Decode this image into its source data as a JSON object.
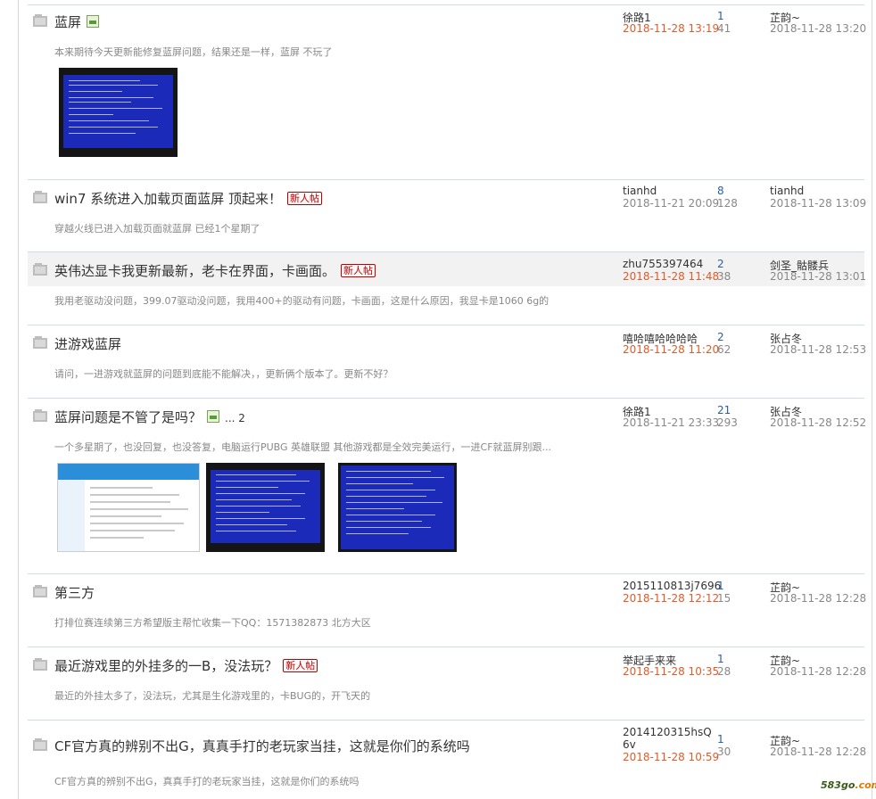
{
  "threads": [
    {
      "title": "蓝屏",
      "has_image_icon": true,
      "is_new": false,
      "desc": "本来期待今天更新能修复蓝屏问题，结果还是一样，蓝屏 不玩了",
      "author": "徐路1",
      "author_date": "2018-11-28 13:19",
      "replies": "1",
      "views": "41",
      "last_poster": "芷韵~",
      "last_date": "2018-11-28 13:20"
    },
    {
      "title": "win7 系统进入加载页面蓝屏 顶起来！",
      "is_new": true,
      "desc": "穿越火线已进入加载页面就蓝屏 已经1个星期了",
      "author": "tianhd",
      "author_date": "2018-11-21 20:09",
      "replies": "8",
      "views": "128",
      "last_poster": "tianhd",
      "last_date": "2018-11-28 13:09"
    },
    {
      "title": "英伟达显卡我更新最新，老卡在界面，卡画面。",
      "is_new": true,
      "desc": "我用老驱动没问题，399.07驱动没问题，我用400+的驱动有问题，卡画面，这是什么原因，我显卡是1060 6g的",
      "author": "zhu755397464",
      "author_date": "2018-11-28 11:48",
      "replies": "2",
      "views": "38",
      "last_poster": "剑圣_骷髅兵",
      "last_date": "2018-11-28 13:01"
    },
    {
      "title": "进游戏蓝屏",
      "desc": "请问，一进游戏就蓝屏的问题到底能不能解决，，更新俩个版本了。更新不好？",
      "author": "嘻哈嘻哈哈哈哈",
      "author_date": "2018-11-28 11:20",
      "replies": "2",
      "views": "62",
      "last_poster": "张占冬",
      "last_date": "2018-11-28 12:53"
    },
    {
      "title": "蓝屏问题是不管了是吗？",
      "has_image_icon": true,
      "pages": "... 2",
      "desc": "一个多星期了，也没回复，也没答复，电脑运行PUBG 英雄联盟 其他游戏都是全效完美运行，一进CF就蓝屏别跟...",
      "author": "徐路1",
      "author_date": "2018-11-21 23:33",
      "replies": "21",
      "views": "293",
      "last_poster": "张占冬",
      "last_date": "2018-11-28 12:52"
    },
    {
      "title": "第三方",
      "desc": "打排位赛连续第三方希望版主帮忙收集一下QQ：1571382873 北方大区",
      "author": "2015110813j7696",
      "author_date": "2018-11-28 12:12",
      "replies": "1",
      "views": "15",
      "last_poster": "芷韵~",
      "last_date": "2018-11-28 12:28"
    },
    {
      "title": "最近游戏里的外挂多的一B，没法玩？",
      "is_new": true,
      "desc": "最近的外挂太多了，没法玩，尤其是生化游戏里的，卡BUG的，开飞天的",
      "author": "举起手来来",
      "author_date": "2018-11-28 10:35",
      "replies": "1",
      "views": "28",
      "last_poster": "芷韵~",
      "last_date": "2018-11-28 12:28"
    },
    {
      "title": "CF官方真的辨别不出G，真真手打的老玩家当挂，这就是你们的系统吗",
      "desc": "CF官方真的辨别不出G，真真手打的老玩家当挂，这就是你们的系统吗",
      "author": "2014120315hsQ6v",
      "author_date": "2018-11-28 10:59",
      "replies": "1",
      "views": "30",
      "last_poster": "芷韵~",
      "last_date": "2018-11-28 12:28"
    }
  ],
  "new_tag_label": "新人帖",
  "watermark": {
    "main": "583go",
    "suffix": ".com"
  }
}
